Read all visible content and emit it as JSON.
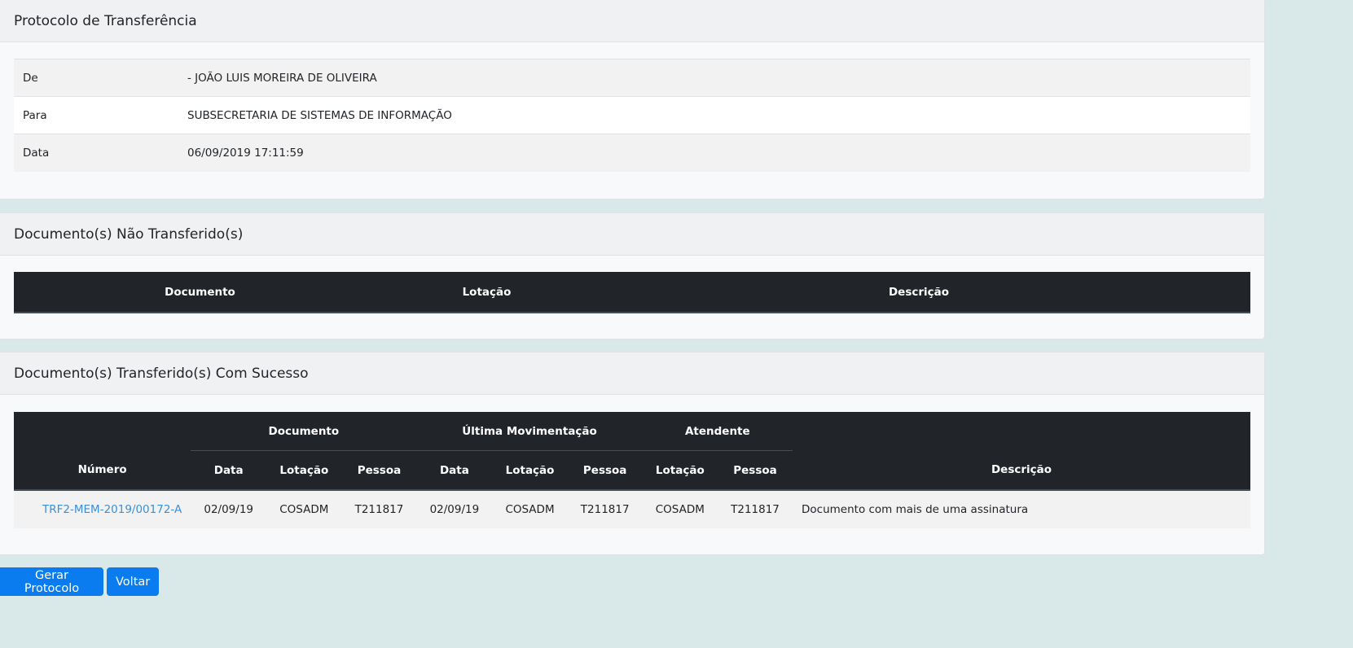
{
  "protocol": {
    "title": "Protocolo de Transferência",
    "rows": [
      {
        "label": "De",
        "value": "- JOÃO LUIS MOREIRA DE OLIVEIRA"
      },
      {
        "label": "Para",
        "value": "SUBSECRETARIA DE SISTEMAS DE INFORMAÇÃO"
      },
      {
        "label": "Data",
        "value": "06/09/2019 17:11:59"
      }
    ]
  },
  "not_transferred": {
    "title": "Documento(s) Não Transferido(s)",
    "columns": [
      "Documento",
      "Lotação",
      "Descrição"
    ]
  },
  "transferred": {
    "title": "Documento(s) Transferido(s) Com Sucesso",
    "group_headers": [
      "Documento",
      "Última Movimentação",
      "Atendente"
    ],
    "columns": [
      "Número",
      "Data",
      "Lotação",
      "Pessoa",
      "Data",
      "Lotação",
      "Pessoa",
      "Lotação",
      "Pessoa",
      "Descrição"
    ],
    "rows": [
      {
        "numero": "TRF2-MEM-2019/00172-A",
        "doc_data": "02/09/19",
        "doc_lotacao": "COSADM",
        "doc_pessoa": "T211817",
        "mov_data": "02/09/19",
        "mov_lotacao": "COSADM",
        "mov_pessoa": "T211817",
        "at_lotacao": "COSADM",
        "at_pessoa": "T211817",
        "descricao": "Documento com mais de uma assinatura"
      }
    ]
  },
  "buttons": {
    "gerar": "Gerar Protocolo",
    "voltar": "Voltar"
  }
}
